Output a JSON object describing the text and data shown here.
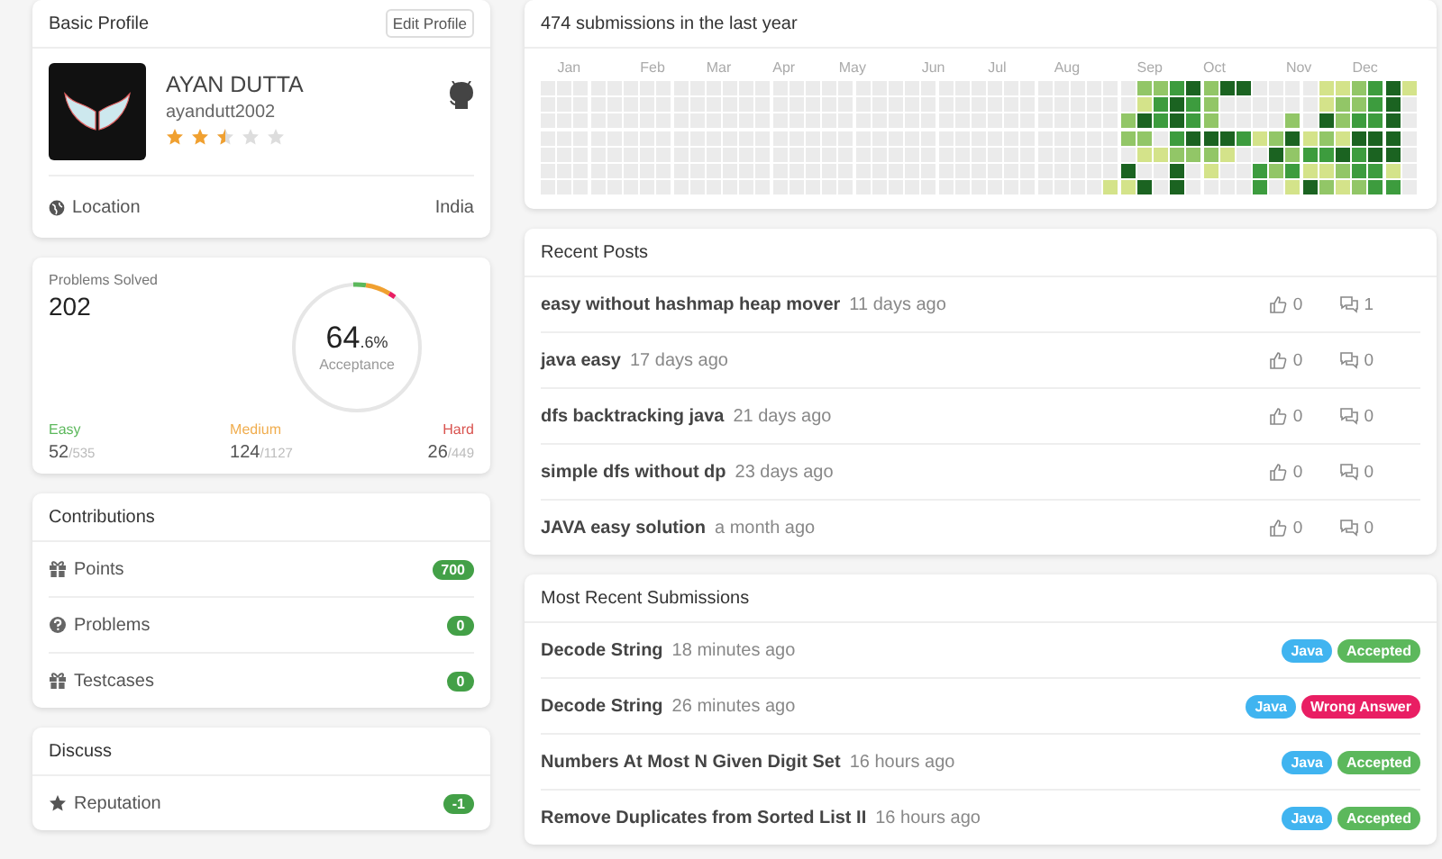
{
  "profile": {
    "title": "Basic Profile",
    "edit_button": "Edit Profile",
    "name": "AYAN DUTTA",
    "username": "ayandutt2002",
    "stars": 2.5,
    "location_label": "Location",
    "location_value": "India"
  },
  "problems": {
    "label": "Problems Solved",
    "solved": "202",
    "acceptance_int": "64",
    "acceptance_frac": ".6%",
    "acceptance_label": "Acceptance",
    "levels": [
      {
        "name": "Easy",
        "color": "#5cb85c",
        "solved": "52",
        "total": "/535"
      },
      {
        "name": "Medium",
        "color": "#f0ad4e",
        "solved": "124",
        "total": "/1127"
      },
      {
        "name": "Hard",
        "color": "#d9534f",
        "solved": "26",
        "total": "/449"
      }
    ]
  },
  "contributions": {
    "title": "Contributions",
    "items": [
      {
        "label": "Points",
        "count": "700"
      },
      {
        "label": "Problems",
        "count": "0"
      },
      {
        "label": "Testcases",
        "count": "0"
      }
    ]
  },
  "discuss": {
    "title": "Discuss",
    "items": [
      {
        "label": "Reputation",
        "count": "-1"
      }
    ]
  },
  "heatmap": {
    "title": "474 submissions in the last year",
    "months": [
      "Jan",
      "Feb",
      "Mar",
      "Apr",
      "May",
      "Jun",
      "Jul",
      "Aug",
      "Sep",
      "Oct",
      "Nov",
      "Dec"
    ]
  },
  "recent_posts": {
    "title": "Recent Posts",
    "rows": [
      {
        "title": "easy without hashmap heap mover",
        "time": "11 days ago",
        "likes": "0",
        "comments": "1"
      },
      {
        "title": "java easy",
        "time": "17 days ago",
        "likes": "0",
        "comments": "0"
      },
      {
        "title": "dfs backtracking java",
        "time": "21 days ago",
        "likes": "0",
        "comments": "0"
      },
      {
        "title": "simple dfs without dp",
        "time": "23 days ago",
        "likes": "0",
        "comments": "0"
      },
      {
        "title": "JAVA easy solution",
        "time": "a month ago",
        "likes": "0",
        "comments": "0"
      }
    ]
  },
  "submissions": {
    "title": "Most Recent Submissions",
    "rows": [
      {
        "title": "Decode String",
        "time": "18 minutes ago",
        "language": "Java",
        "status": "Accepted",
        "color": "#5cb85c"
      },
      {
        "title": "Decode String",
        "time": "26 minutes ago",
        "language": "Java",
        "status": "Wrong Answer",
        "color": "#e91e63"
      },
      {
        "title": "Numbers At Most N Given Digit Set",
        "time": "16 hours ago",
        "language": "Java",
        "status": "Accepted",
        "color": "#5cb85c"
      },
      {
        "title": "Remove Duplicates from Sorted List II",
        "time": "16 hours ago",
        "language": "Java",
        "status": "Accepted",
        "color": "#5cb85c"
      }
    ]
  }
}
